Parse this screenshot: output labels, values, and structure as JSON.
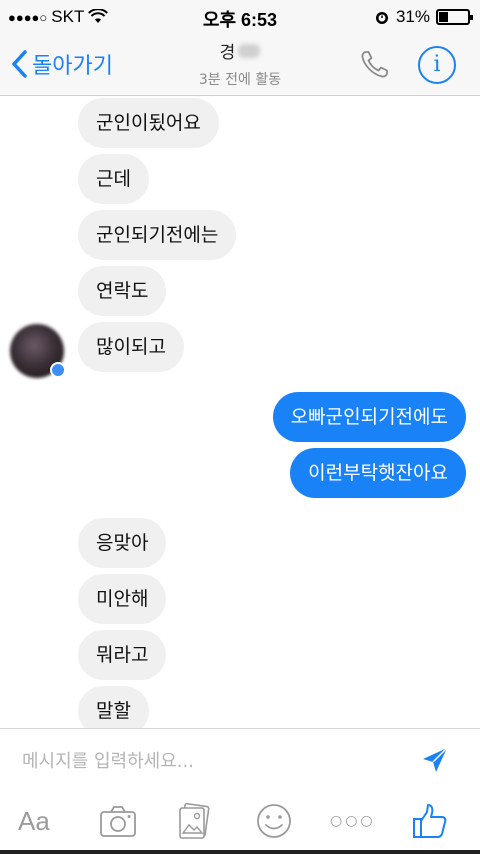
{
  "status_bar": {
    "signal_dots": "●●●●○",
    "carrier": "SKT",
    "time": "오후 6:53",
    "battery_pct": "31%",
    "battery_level": 0.31
  },
  "nav": {
    "back_label": "돌아가기",
    "contact_name_visible": "경",
    "status": "3분 전에 활동",
    "accent": "#1a82f7"
  },
  "messages": [
    {
      "dir": "in",
      "text": "군인이됬어요"
    },
    {
      "dir": "in",
      "text": "근데"
    },
    {
      "dir": "in",
      "text": "군인되기전에는"
    },
    {
      "dir": "in",
      "text": "연락도"
    },
    {
      "dir": "in",
      "text": "많이되고"
    },
    {
      "dir": "out",
      "text": "오빠군인되기전에도"
    },
    {
      "dir": "out",
      "text": "이런부탁햇잔아요"
    },
    {
      "dir": "in",
      "text": "응맞아"
    },
    {
      "dir": "in",
      "text": "미안해"
    },
    {
      "dir": "in",
      "text": "뭐라고"
    },
    {
      "dir": "in",
      "text": "말할"
    }
  ],
  "composer": {
    "placeholder": "메시지를 입력하세요...",
    "toolbar": {
      "aa_label": "Aa",
      "more_label": "○○○"
    }
  },
  "icons": {
    "back": "chevron-left-icon",
    "call": "phone-icon",
    "info": "info-icon",
    "send": "send-icon",
    "camera": "camera-icon",
    "gallery": "gallery-icon",
    "sticker": "smiley-icon",
    "like": "thumbs-up-icon"
  }
}
